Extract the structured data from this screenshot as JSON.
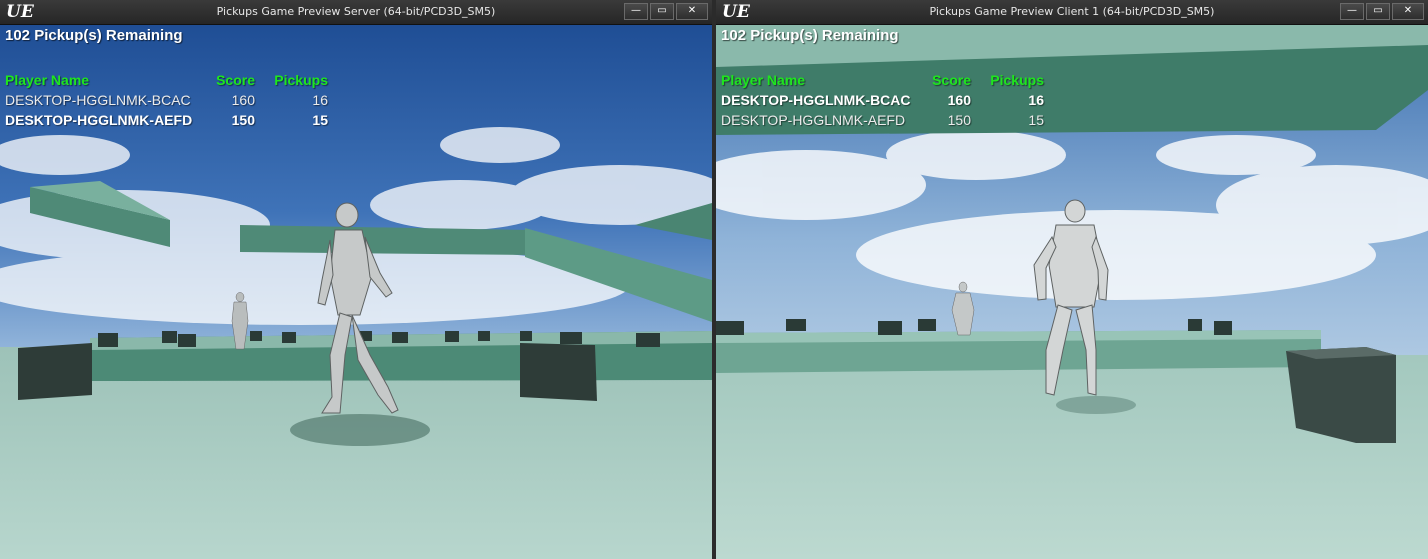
{
  "windows": [
    {
      "title": "Pickups Game Preview Server (64-bit/PCD3D_SM5)",
      "logo": "UE",
      "hud": {
        "remaining": "102 Pickup(s) Remaining",
        "headers": {
          "name": "Player Name",
          "score": "Score",
          "pickups": "Pickups"
        },
        "rows": [
          {
            "name": "DESKTOP-HGGLNMK-BCAC",
            "score": "160",
            "pickups": "16",
            "local": false
          },
          {
            "name": "DESKTOP-HGGLNMK-AEFD",
            "score": "150",
            "pickups": "15",
            "local": true
          }
        ]
      }
    },
    {
      "title": "Pickups Game Preview Client 1 (64-bit/PCD3D_SM5)",
      "logo": "UE",
      "hud": {
        "remaining": "102 Pickup(s) Remaining",
        "headers": {
          "name": "Player Name",
          "score": "Score",
          "pickups": "Pickups"
        },
        "rows": [
          {
            "name": "DESKTOP-HGGLNMK-BCAC",
            "score": "160",
            "pickups": "16",
            "local": true
          },
          {
            "name": "DESKTOP-HGGLNMK-AEFD",
            "score": "150",
            "pickups": "15",
            "local": false
          }
        ]
      }
    }
  ],
  "controls": {
    "minimize": "—",
    "maximize": "▭",
    "close": "✕"
  },
  "colors": {
    "hud_header": "#1ee61e",
    "hud_text": "#ffffff",
    "floor": "#a9cdc3",
    "platform": "#5f9e89"
  }
}
